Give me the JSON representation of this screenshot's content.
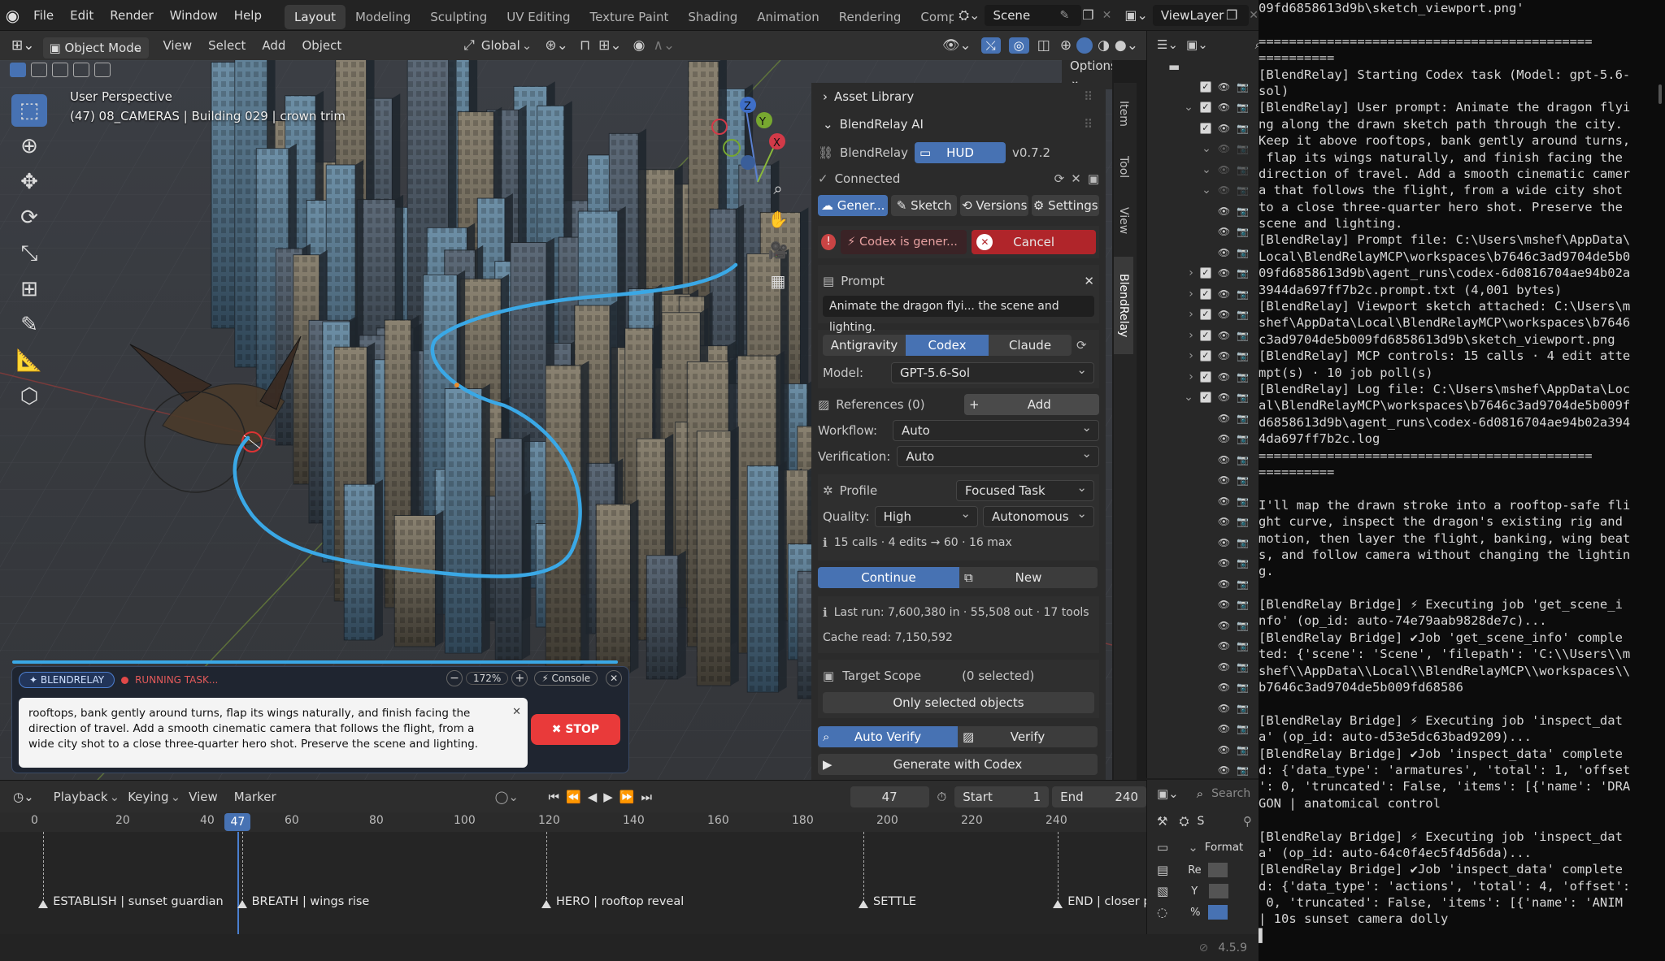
{
  "topbar": {
    "menus": [
      "File",
      "Edit",
      "Render",
      "Window",
      "Help"
    ],
    "workspaces": [
      "Layout",
      "Modeling",
      "Sculpting",
      "UV Editing",
      "Texture Paint",
      "Shading",
      "Animation",
      "Rendering",
      "Compos"
    ],
    "active_workspace": "Layout",
    "scene": "Scene",
    "view_layer": "ViewLayer"
  },
  "header": {
    "mode": "Object Mode",
    "menus": [
      "View",
      "Select",
      "Add",
      "Object"
    ],
    "transform": "Global",
    "options": "Options"
  },
  "viewport": {
    "perspective": "User Perspective",
    "context": "(47) 08_CAMERAS | Building 029 | crown trim"
  },
  "npanel": {
    "asset_library": "Asset Library",
    "addon_title": "BlendRelay AI",
    "brand": "BlendRelay",
    "hud": "HUD",
    "version": "v0.7.2",
    "status": "Connected",
    "tabs": [
      "Gener...",
      "Sketch",
      "Versions",
      "Settings"
    ],
    "generating": "Codex is gener...",
    "cancel": "Cancel",
    "prompt_label": "Prompt",
    "prompt_value": "Animate the dragon flyi... the scene and lighting.",
    "providers": [
      "Antigravity",
      "Codex",
      "Claude"
    ],
    "model_label": "Model:",
    "model_value": "GPT-5.6-Sol",
    "references": "References (0)",
    "add": "Add",
    "workflow_label": "Workflow:",
    "workflow_value": "Auto",
    "verification_label": "Verification:",
    "verification_value": "Auto",
    "profile_label": "Profile",
    "profile_value": "Focused Task",
    "quality_label": "Quality:",
    "quality_value": "High",
    "autonomy_value": "Autonomous",
    "calls": "15 calls · 4 edits → 60 · 16 max",
    "continue": "Continue",
    "new": "New",
    "last_run": "Last run: 7,600,380 in · 55,508 out · 17 tools",
    "cache_read": "Cache read: 7,150,592",
    "target_scope": "Target Scope",
    "target_selected": "(0 selected)",
    "only_selected": "Only selected objects",
    "auto_verify": "Auto Verify",
    "verify": "Verify",
    "generate": "Generate with Codex"
  },
  "sidetabs": [
    "Item",
    "Tool",
    "View",
    "BlendRelay"
  ],
  "relay_overlay": {
    "badge": "✦ BLENDRELAY",
    "status": "RUNNING TASK...",
    "zoom": "172%",
    "console_btn": "⚡ Console",
    "text": "rooftops, bank gently around turns, flap its wings naturally, and finish facing the direction of travel. Add a smooth cinematic camera that follows the flight, from a wide city shot to a close three-quarter hero shot. Preserve the scene and lighting.",
    "stop": "✖ STOP"
  },
  "timeline_header": {
    "menus": [
      "Playback",
      "Keying",
      "View",
      "Marker"
    ],
    "frame": "47",
    "start_label": "Start",
    "start": "1",
    "end_label": "End",
    "end": "240"
  },
  "timeline": {
    "ticks": [
      "0",
      "20",
      "40",
      "60",
      "80",
      "100",
      "120",
      "140",
      "160",
      "180",
      "200",
      "220",
      "240"
    ],
    "current": "47",
    "markers": [
      "ESTABLISH | sunset guardian",
      "BREATH | wings rise",
      "HERO | rooftop reveal",
      "SETTLE",
      "END | closer p"
    ]
  },
  "props": {
    "search": "Search",
    "scene_short": "S",
    "format": "Format",
    "rows": [
      "Re",
      "Y",
      "%"
    ]
  },
  "status": {
    "version": "4.5.9"
  },
  "console_lines": [
    "09fd6858613d9b\\sketch_viewport.png'",
    "",
    "============================================",
    "==========",
    "[BlendRelay] Starting Codex task (Model: gpt-5.6-",
    "sol)",
    "[BlendRelay] User prompt: Animate the dragon flyi",
    "ng along the drawn sketch path through the city.",
    "Keep it above rooftops, bank gently around turns,",
    " flap its wings naturally, and finish facing the",
    "direction of travel. Add a smooth cinematic camer",
    "a that follows the flight, from a wide city shot",
    "to a close three-quarter hero shot. Preserve the",
    "scene and lighting.",
    "[BlendRelay] Prompt file: C:\\Users\\mshef\\AppData\\",
    "Local\\BlendRelayMCP\\workspaces\\b7646c3ad9704de5b0",
    "09fd6858613d9b\\agent_runs\\codex-6d0816704ae94b02a",
    "3944da697ff7b2c.prompt.txt (4,001 bytes)",
    "[BlendRelay] Viewport sketch attached: C:\\Users\\m",
    "shef\\AppData\\Local\\BlendRelayMCP\\workspaces\\b7646",
    "c3ad9704de5b009fd6858613d9b\\sketch_viewport.png",
    "[BlendRelay] MCP controls: 15 calls · 4 edit atte",
    "mpt(s) · 10 job poll(s)",
    "[BlendRelay] Log file: C:\\Users\\mshef\\AppData\\Loc",
    "al\\BlendRelayMCP\\workspaces\\b7646c3ad9704de5b009f",
    "d6858613d9b\\agent_runs\\codex-6d0816704ae94b02a394",
    "4da697ff7b2c.log",
    "============================================",
    "==========",
    "",
    "I'll map the drawn stroke into a rooftop-safe fli",
    "ght curve, inspect the dragon's existing rig and",
    "motion, then layer the flight, banking, wing beat",
    "s, and follow camera without changing the lightin",
    "g.",
    "",
    "[BlendRelay Bridge] ⚡ Executing job 'get_scene_i",
    "nfo' (op_id: auto-74e79aab9828de7c)...",
    "[BlendRelay Bridge] ✔Job 'get_scene_info' comple",
    "ted: {'scene': 'Scene', 'filepath': 'C:\\\\Users\\\\m",
    "shef\\\\AppData\\\\Local\\\\BlendRelayMCP\\\\workspaces\\\\",
    "b7646c3ad9704de5b009fd68586",
    "",
    "[BlendRelay Bridge] ⚡ Executing job 'inspect_dat",
    "a' (op_id: auto-d53e5dc63bad9209)...",
    "[BlendRelay Bridge] ✔Job 'inspect_data' complete",
    "d: {'data_type': 'armatures', 'total': 1, 'offset",
    "': 0, 'truncated': False, 'items': [{'name': 'DRA",
    "GON | anatomical control",
    "",
    "[BlendRelay Bridge] ⚡ Executing job 'inspect_dat",
    "a' (op_id: auto-64c0f4ec5f4d56da)...",
    "[BlendRelay Bridge] ✔Job 'inspect_data' complete",
    "d: {'data_type': 'actions', 'total': 4, 'offset':",
    " 0, 'truncated': False, 'items': [{'name': 'ANIM",
    "| 10s sunset camera dolly",
    "▌"
  ]
}
